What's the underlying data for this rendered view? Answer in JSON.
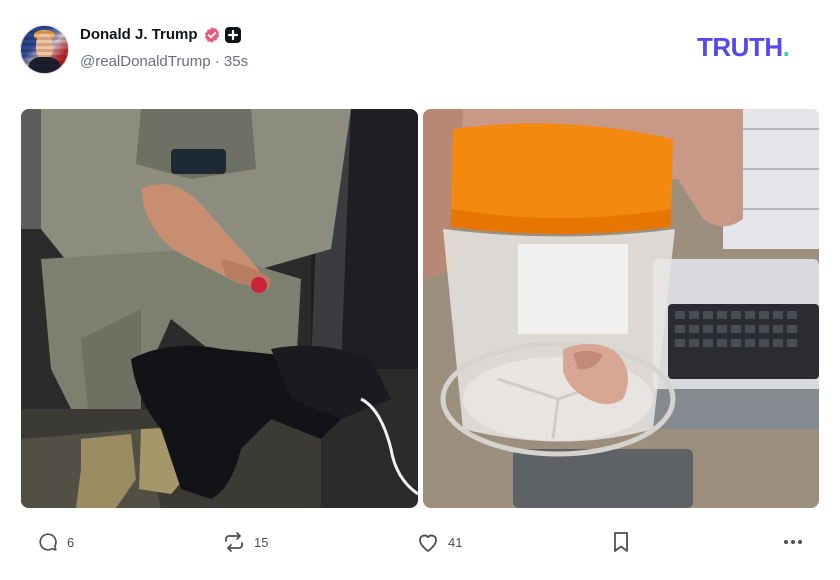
{
  "post": {
    "author_name": "Donald J. Trump",
    "handle": "@realDonaldTrump",
    "separator": "·",
    "time_ago": "35s"
  },
  "brand": {
    "logo_text": "TRUTH",
    "logo_dot": ".",
    "logo_color": "#5448ee",
    "dot_color": "#3ad1c2",
    "verified_color": "#e8597a"
  },
  "actions": {
    "replies": "6",
    "retruths": "15",
    "likes": "41"
  },
  "icons": [
    "verified-badge-icon",
    "plus-badge-icon",
    "reply-icon",
    "retruth-icon",
    "like-icon",
    "bookmark-icon",
    "more-icon"
  ]
}
